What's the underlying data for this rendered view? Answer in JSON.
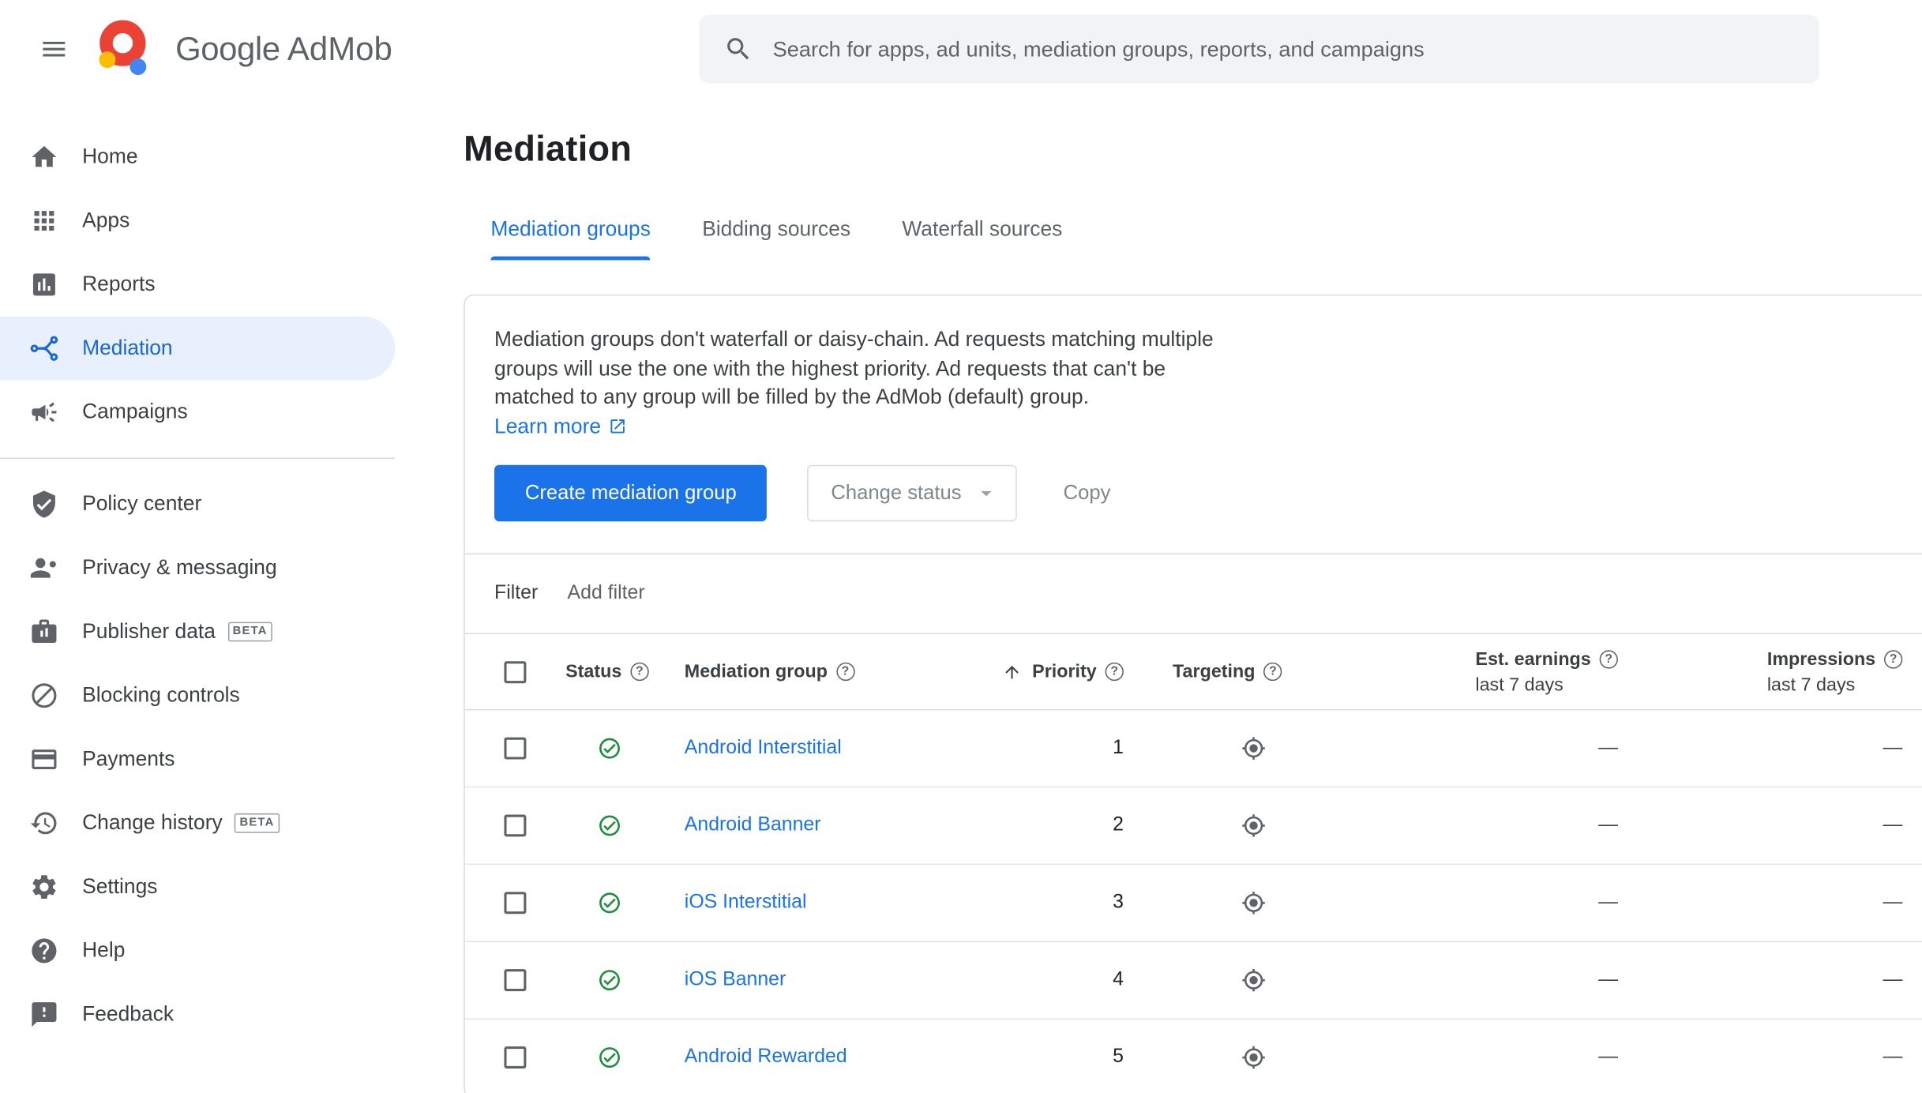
{
  "topbar": {
    "brand": {
      "part1": "Google",
      "part2": "AdMob"
    },
    "search_placeholder": "Search for apps, ad units, mediation groups, reports, and campaigns"
  },
  "sidebar": {
    "items": [
      {
        "label": "Home"
      },
      {
        "label": "Apps"
      },
      {
        "label": "Reports"
      },
      {
        "label": "Mediation"
      },
      {
        "label": "Campaigns"
      },
      {
        "label": "Policy center"
      },
      {
        "label": "Privacy & messaging"
      },
      {
        "label": "Publisher data",
        "badge": "BETA"
      },
      {
        "label": "Blocking controls"
      },
      {
        "label": "Payments"
      },
      {
        "label": "Change history",
        "badge": "BETA"
      },
      {
        "label": "Settings"
      },
      {
        "label": "Help"
      },
      {
        "label": "Feedback"
      }
    ]
  },
  "page": {
    "title": "Mediation",
    "tabs": [
      {
        "label": "Mediation groups"
      },
      {
        "label": "Bidding sources"
      },
      {
        "label": "Waterfall sources"
      }
    ],
    "info": {
      "text": "Mediation groups don't waterfall or daisy-chain. Ad requests matching multiple groups will use the one with the highest priority. Ad requests that can't be matched to any group will be filled by the AdMob (default) group.",
      "link_label": "Learn more"
    },
    "actions": {
      "create": "Create mediation group",
      "change_status": "Change status",
      "copy": "Copy"
    },
    "filterbar": {
      "label": "Filter",
      "add_filter": "Add filter"
    },
    "table": {
      "headers": {
        "status": "Status",
        "group": "Mediation group",
        "priority": "Priority",
        "targeting": "Targeting",
        "earnings": "Est. earnings",
        "earnings_sub": "last 7 days",
        "impressions": "Impressions",
        "impressions_sub": "last 7 days"
      },
      "rows": [
        {
          "name": "Android Interstitial",
          "priority": "1",
          "earnings": "—",
          "impressions": "—"
        },
        {
          "name": "Android Banner",
          "priority": "2",
          "earnings": "—",
          "impressions": "—"
        },
        {
          "name": "iOS Interstitial",
          "priority": "3",
          "earnings": "—",
          "impressions": "—"
        },
        {
          "name": "iOS Banner",
          "priority": "4",
          "earnings": "—",
          "impressions": "—"
        },
        {
          "name": "Android Rewarded",
          "priority": "5",
          "earnings": "—",
          "impressions": "—"
        }
      ]
    }
  },
  "colors": {
    "accent_blue": "#1a73e8",
    "active_item_bg": "#e8f0fe",
    "status_green": "#1e8e3e",
    "border": "#dadce0"
  }
}
